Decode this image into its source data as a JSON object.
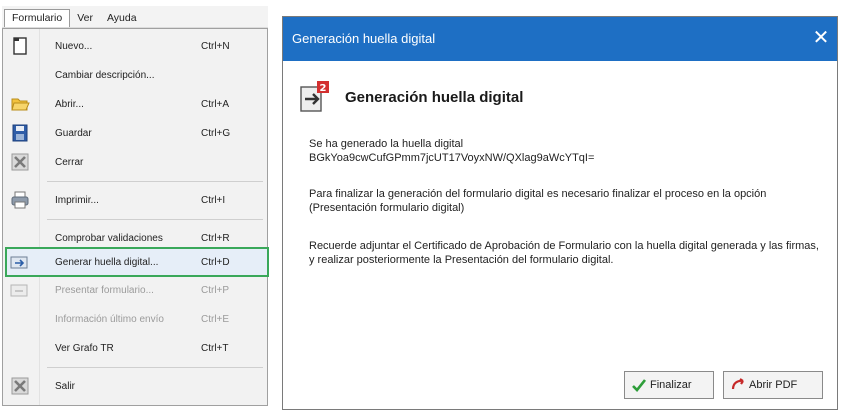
{
  "menubar": {
    "items": [
      "Formulario",
      "Ver",
      "Ayuda"
    ]
  },
  "menu": {
    "items": [
      {
        "label": "Nuevo...",
        "shortcut": "Ctrl+N",
        "icon": "new-document-icon",
        "enabled": true
      },
      {
        "label": "Cambiar descripción...",
        "shortcut": "",
        "icon": "",
        "enabled": true
      },
      {
        "label": "Abrir...",
        "shortcut": "Ctrl+A",
        "icon": "folder-open-icon",
        "enabled": true
      },
      {
        "label": "Guardar",
        "shortcut": "Ctrl+G",
        "icon": "save-disk-icon",
        "enabled": true
      },
      {
        "label": "Cerrar",
        "shortcut": "",
        "icon": "close-x-icon",
        "enabled": true
      },
      {
        "label": "Imprimir...",
        "shortcut": "Ctrl+I",
        "icon": "printer-icon",
        "enabled": true
      },
      {
        "label": "Comprobar validaciones",
        "shortcut": "Ctrl+R",
        "icon": "",
        "enabled": true
      },
      {
        "label": "Generar huella digital...",
        "shortcut": "Ctrl+D",
        "icon": "fingerprint-export-icon",
        "enabled": true
      },
      {
        "label": "Presentar formulario...",
        "shortcut": "Ctrl+P",
        "icon": "submit-form-icon",
        "enabled": false
      },
      {
        "label": "Información último envío",
        "shortcut": "Ctrl+E",
        "icon": "",
        "enabled": false
      },
      {
        "label": "Ver Grafo TR",
        "shortcut": "Ctrl+T",
        "icon": "",
        "enabled": true
      },
      {
        "label": "Salir",
        "shortcut": "",
        "icon": "exit-x-icon",
        "enabled": true
      }
    ]
  },
  "dialog": {
    "title": "Generación huella digital",
    "close_glyph": "✕",
    "heading": "Generación huella digital",
    "line1": "Se ha generado la huella digital",
    "hash": "BGkYoa9cwCufGPmm7jcUT17VoyxNW/QXlag9aWcYTqI=",
    "paragraph2": "Para finalizar la generación del formulario digital es necesario finalizar el proceso en la opción (Presentación formulario digital)",
    "paragraph3": "Recuerde adjuntar el Certificado de Aprobación de Formulario con la huella digital generada y las firmas, y realizar posteriormente la Presentación del formulario digital.",
    "buttons": {
      "finalizar": "Finalizar",
      "abrir_pdf": "Abrir PDF"
    }
  },
  "colors": {
    "titlebar": "#1e6fc4",
    "highlight_border": "#3aa85a",
    "disabled_text": "#9b9b9b"
  }
}
